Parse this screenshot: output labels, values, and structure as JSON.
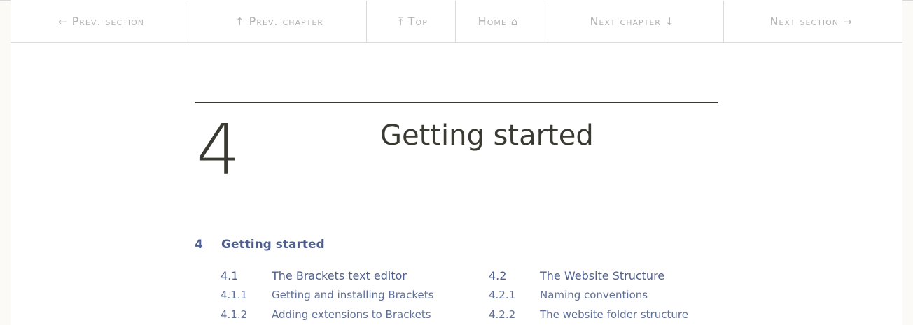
{
  "nav": {
    "prev_section": "Prev. section",
    "prev_chapter": "Prev. chapter",
    "top": "Top",
    "home": "Home",
    "next_chapter": "Next chapter",
    "next_section": "Next section"
  },
  "chapter": {
    "number": "4",
    "title": "Getting started"
  },
  "toc": {
    "main": {
      "num": "4",
      "label": "Getting started"
    },
    "col1": {
      "num": "4.1",
      "label": "The Brackets text editor",
      "items": [
        {
          "num": "4.1.1",
          "label": "Getting and installing Brackets"
        },
        {
          "num": "4.1.2",
          "label": "Adding extensions to Brackets"
        }
      ]
    },
    "col2": {
      "num": "4.2",
      "label": "The Website Structure",
      "items": [
        {
          "num": "4.2.1",
          "label": "Naming conventions"
        },
        {
          "num": "4.2.2",
          "label": "The website folder structure"
        }
      ]
    }
  }
}
